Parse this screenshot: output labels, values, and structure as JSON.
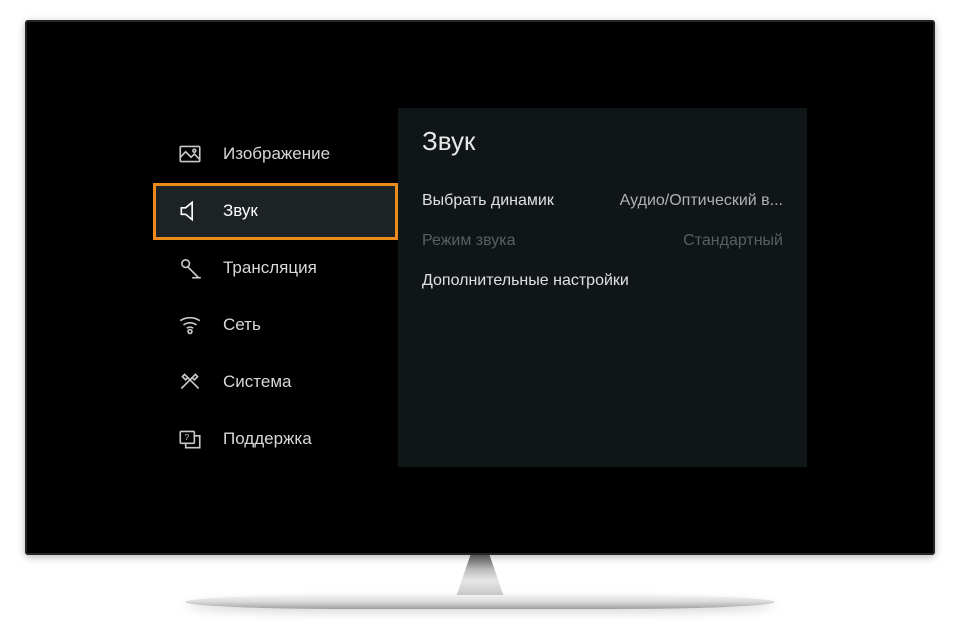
{
  "sidebar": {
    "items": [
      {
        "label": "Изображение",
        "icon": "picture-icon",
        "selected": false
      },
      {
        "label": "Звук",
        "icon": "sound-icon",
        "selected": true
      },
      {
        "label": "Трансляция",
        "icon": "broadcast-icon",
        "selected": false
      },
      {
        "label": "Сеть",
        "icon": "network-icon",
        "selected": false
      },
      {
        "label": "Система",
        "icon": "system-icon",
        "selected": false
      },
      {
        "label": "Поддержка",
        "icon": "support-icon",
        "selected": false
      }
    ]
  },
  "content": {
    "title": "Звук",
    "rows": [
      {
        "label": "Выбрать динамик",
        "value": "Аудио/Оптический в...",
        "disabled": false
      },
      {
        "label": "Режим звука",
        "value": "Стандартный",
        "disabled": true
      },
      {
        "label": "Дополнительные настройки",
        "value": "",
        "disabled": false
      }
    ]
  },
  "highlight_color": "#ea8b1b"
}
